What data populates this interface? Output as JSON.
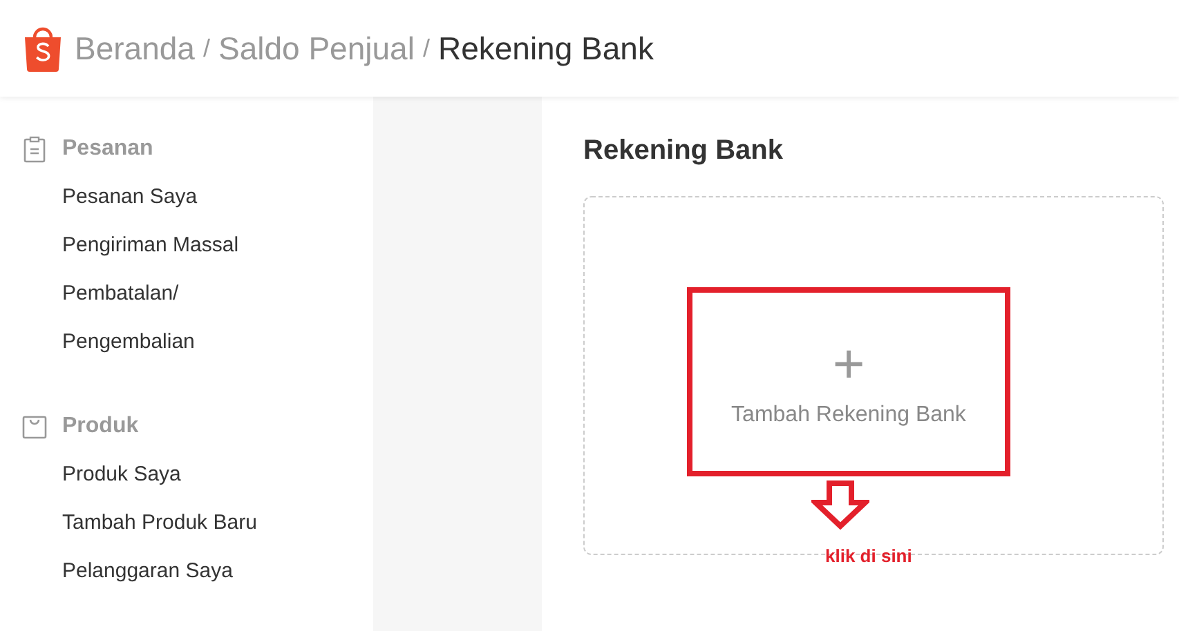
{
  "breadcrumb_separator": "/",
  "breadcrumb": [
    {
      "label": "Beranda",
      "current": false
    },
    {
      "label": "Saldo Penjual",
      "current": false
    },
    {
      "label": "Rekening Bank",
      "current": true
    }
  ],
  "sidebar": {
    "sections": [
      {
        "title": "Pesanan",
        "kind": "clipboard",
        "items": [
          "Pesanan Saya",
          "Pengiriman Massal",
          "Pembatalan/",
          "Pengembalian"
        ]
      },
      {
        "title": "Produk",
        "kind": "bag",
        "items": [
          "Produk Saya",
          "Tambah Produk Baru",
          "Pelanggaran Saya"
        ]
      }
    ]
  },
  "page": {
    "title": "Rekening Bank",
    "add_button": {
      "icon": "+",
      "label": "Tambah Rekening Bank"
    },
    "annotation": "klik di sini"
  }
}
